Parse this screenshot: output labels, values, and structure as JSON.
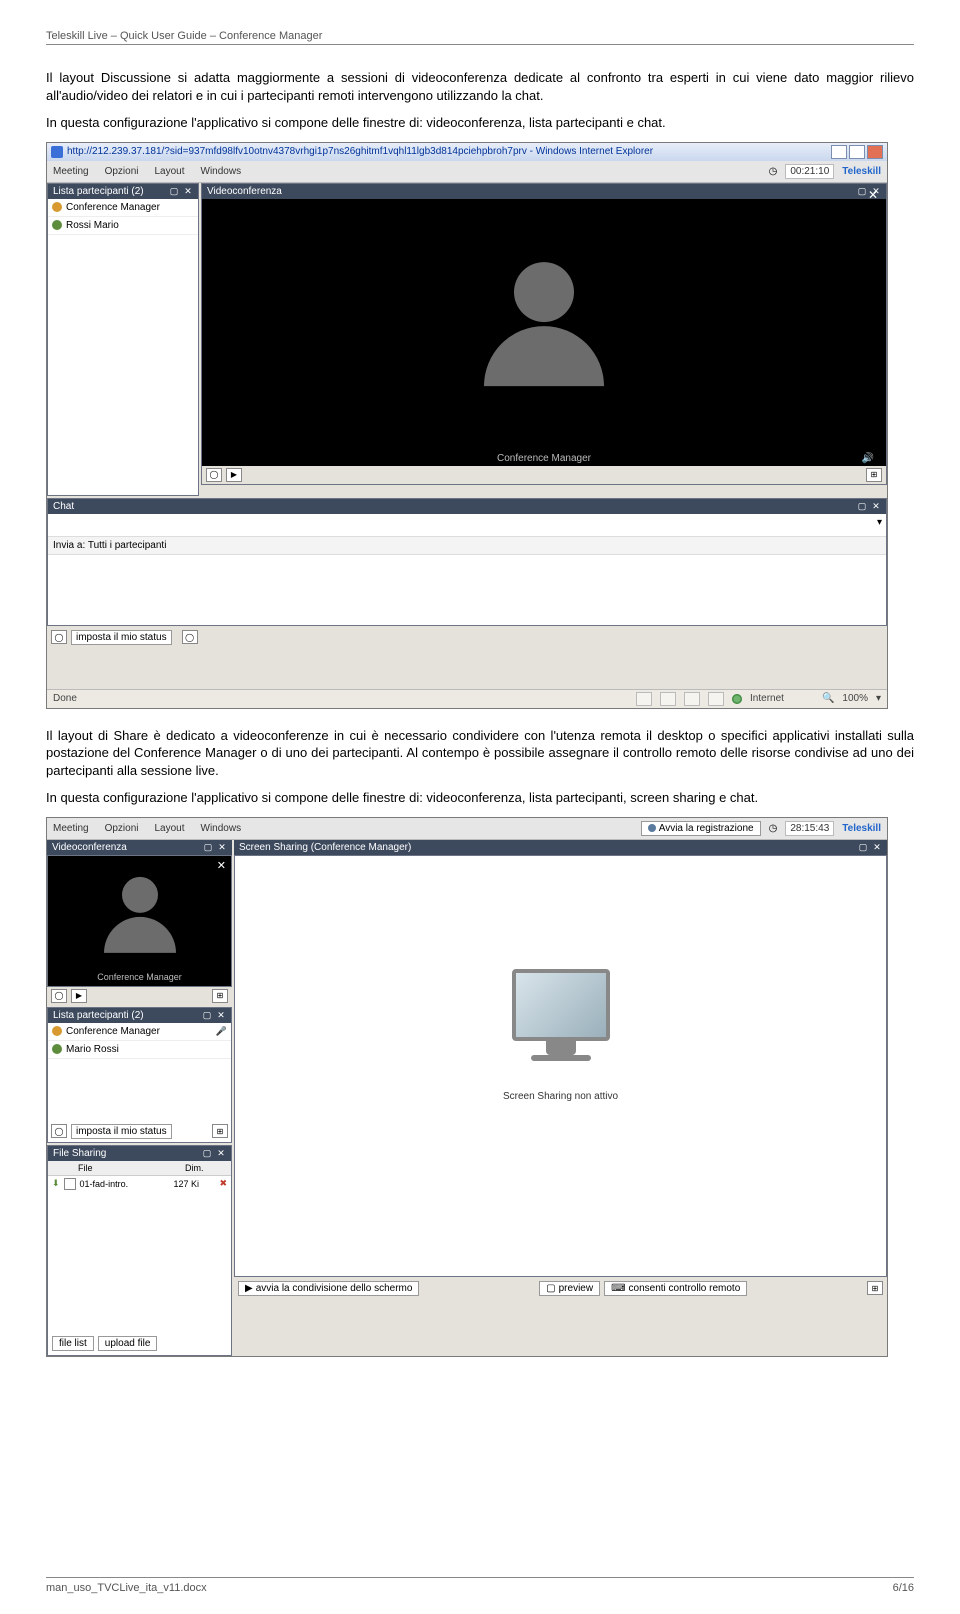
{
  "header": "Teleskill Live – Quick User Guide – Conference Manager",
  "paragraphs": {
    "p1": "Il layout Discussione si adatta maggiormente a sessioni di videoconferenza dedicate al confronto tra esperti in cui viene dato maggior rilievo all'audio/video dei relatori e in cui i partecipanti remoti intervengono utilizzando la chat.",
    "p2": "In questa configurazione l'applicativo si compone delle finestre di: videoconferenza, lista partecipanti e chat.",
    "p3": "Il layout di Share è dedicato a videoconferenze in cui è necessario condividere con l'utenza remota il desktop o specifici applicativi installati sulla postazione del Conference Manager o di uno dei partecipanti. Al contempo è possibile assegnare il controllo remoto delle risorse condivise ad uno dei partecipanti alla sessione live.",
    "p4": "In questa configurazione l'applicativo si compone delle finestre di: videoconferenza, lista partecipanti, screen sharing e chat."
  },
  "screenshot1": {
    "ie_title": "http://212.239.37.181/?sid=937mfd98lfv10otnv4378vrhgi1p7ns26ghitmf1vqhl11lgb3d814pciehpbroh7prv - Windows Internet Explorer",
    "menubar": [
      "Meeting",
      "Opzioni",
      "Layout",
      "Windows"
    ],
    "timer": "00:21:10",
    "brand": "Teleskill",
    "panels": {
      "participants_title": "Lista partecipanti (2)",
      "participants": [
        "Conference Manager",
        "Rossi Mario"
      ],
      "video_title": "Videoconferenza",
      "video_user_label": "Conference Manager",
      "chat_title": "Chat",
      "invia_label": "Invia a:",
      "invia_value": "Tutti i partecipanti",
      "status_input": "imposta il mio status"
    },
    "statusbar": {
      "left": "Done",
      "zone": "Internet",
      "zoom": "100%"
    }
  },
  "screenshot2": {
    "menubar": [
      "Meeting",
      "Opzioni",
      "Layout",
      "Windows"
    ],
    "rec_button": "Avvia la registrazione",
    "timer": "28:15:43",
    "brand": "Teleskill",
    "video_title": "Videoconferenza",
    "video_user_label": "Conference Manager",
    "participants_title": "Lista partecipanti (2)",
    "participants": [
      "Conference Manager",
      "Mario Rossi"
    ],
    "status_input": "imposta il mio status",
    "file_sharing_title": "File Sharing",
    "file_headers": [
      "File",
      "Dim."
    ],
    "file_rows": [
      {
        "name": "01-fad-intro.",
        "size": "127 Ki"
      }
    ],
    "file_buttons": [
      "file list",
      "upload file"
    ],
    "screen_title": "Screen Sharing (Conference Manager)",
    "screen_text": "Screen Sharing non attivo",
    "screen_buttons": [
      "avvia la condivisione dello schermo",
      "preview",
      "consenti controllo remoto"
    ]
  },
  "footer": {
    "left": "man_uso_TVCLive_ita_v11.docx",
    "right": "6/16"
  }
}
